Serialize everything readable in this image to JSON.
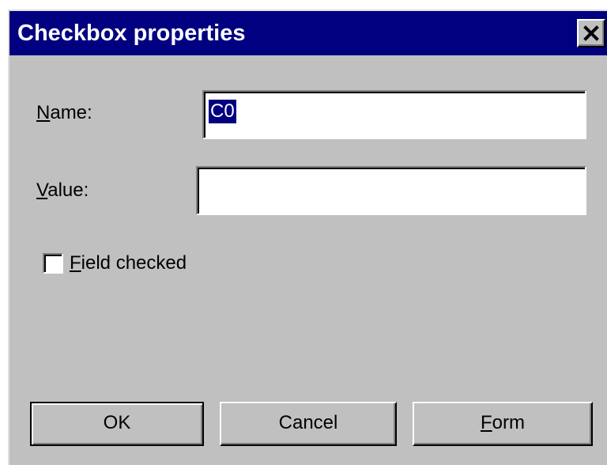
{
  "window": {
    "title": "Checkbox properties"
  },
  "form": {
    "name_label_mnemonic": "N",
    "name_label_rest": "ame:",
    "name_value": "C0",
    "value_label_mnemonic": "V",
    "value_label_rest": "alue:",
    "value_value": "",
    "checkbox_label_mnemonic": "F",
    "checkbox_label_rest": "ield checked",
    "checkbox_checked": false
  },
  "buttons": {
    "ok_label": "OK",
    "cancel_label": "Cancel",
    "form_mnemonic": "F",
    "form_rest": "orm"
  },
  "colors": {
    "titlebar": "#000080",
    "face": "#c0c0c0",
    "selection": "#000080"
  }
}
